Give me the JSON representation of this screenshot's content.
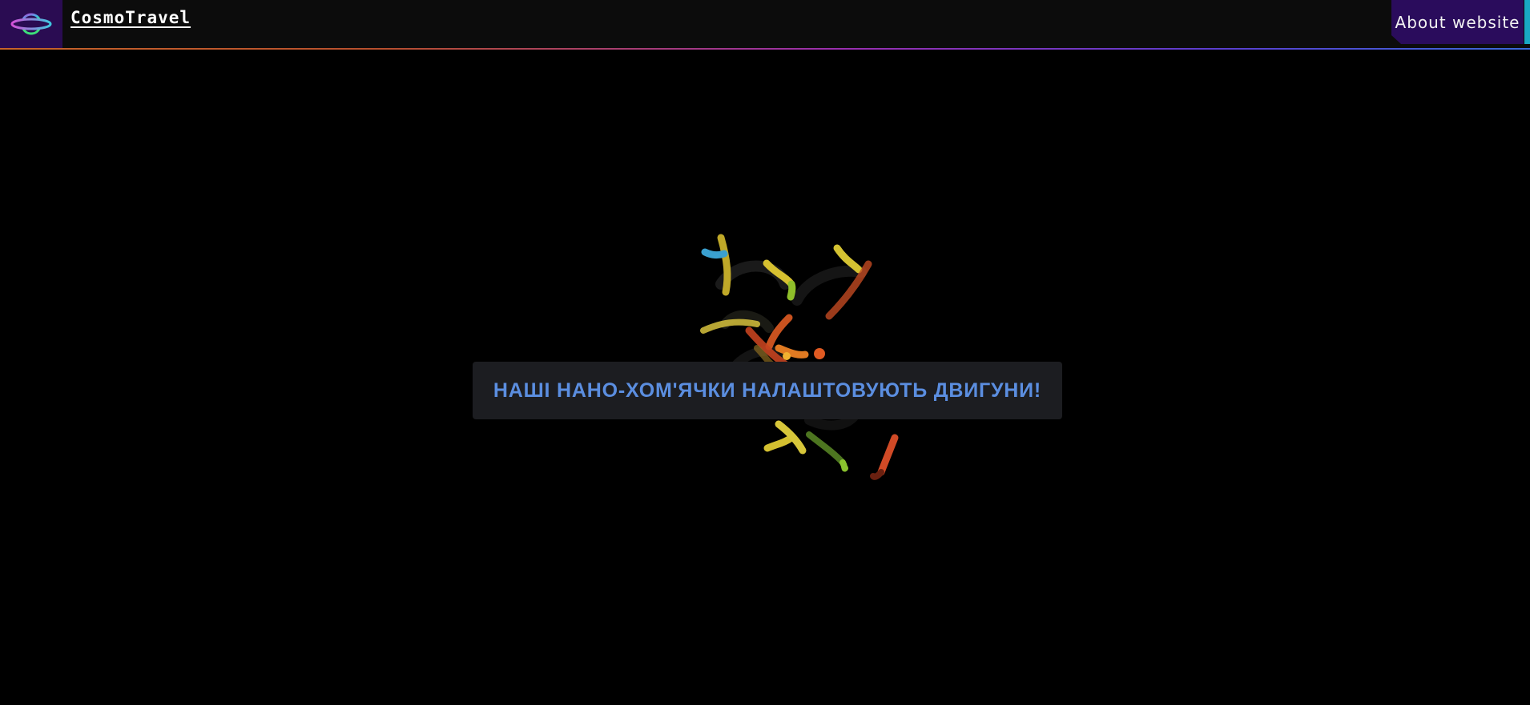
{
  "header": {
    "brand": "CosmoTravel",
    "logo_icon": "planet-ring-icon",
    "about_label": "About website"
  },
  "loading": {
    "message": "НАШІ НАНО-ХОМ'ЯЧКИ НАЛАШТОВУЮТЬ ДВИГУНИ!"
  },
  "colors": {
    "background": "#000000",
    "header_bg": "#0c0c0c",
    "logo_bg": "#2a0c52",
    "about_bg": "#2a0c5c",
    "accent_cyan": "#19a8c4",
    "banner_bg": "#1c1d21",
    "banner_text": "#5b8ee0"
  }
}
